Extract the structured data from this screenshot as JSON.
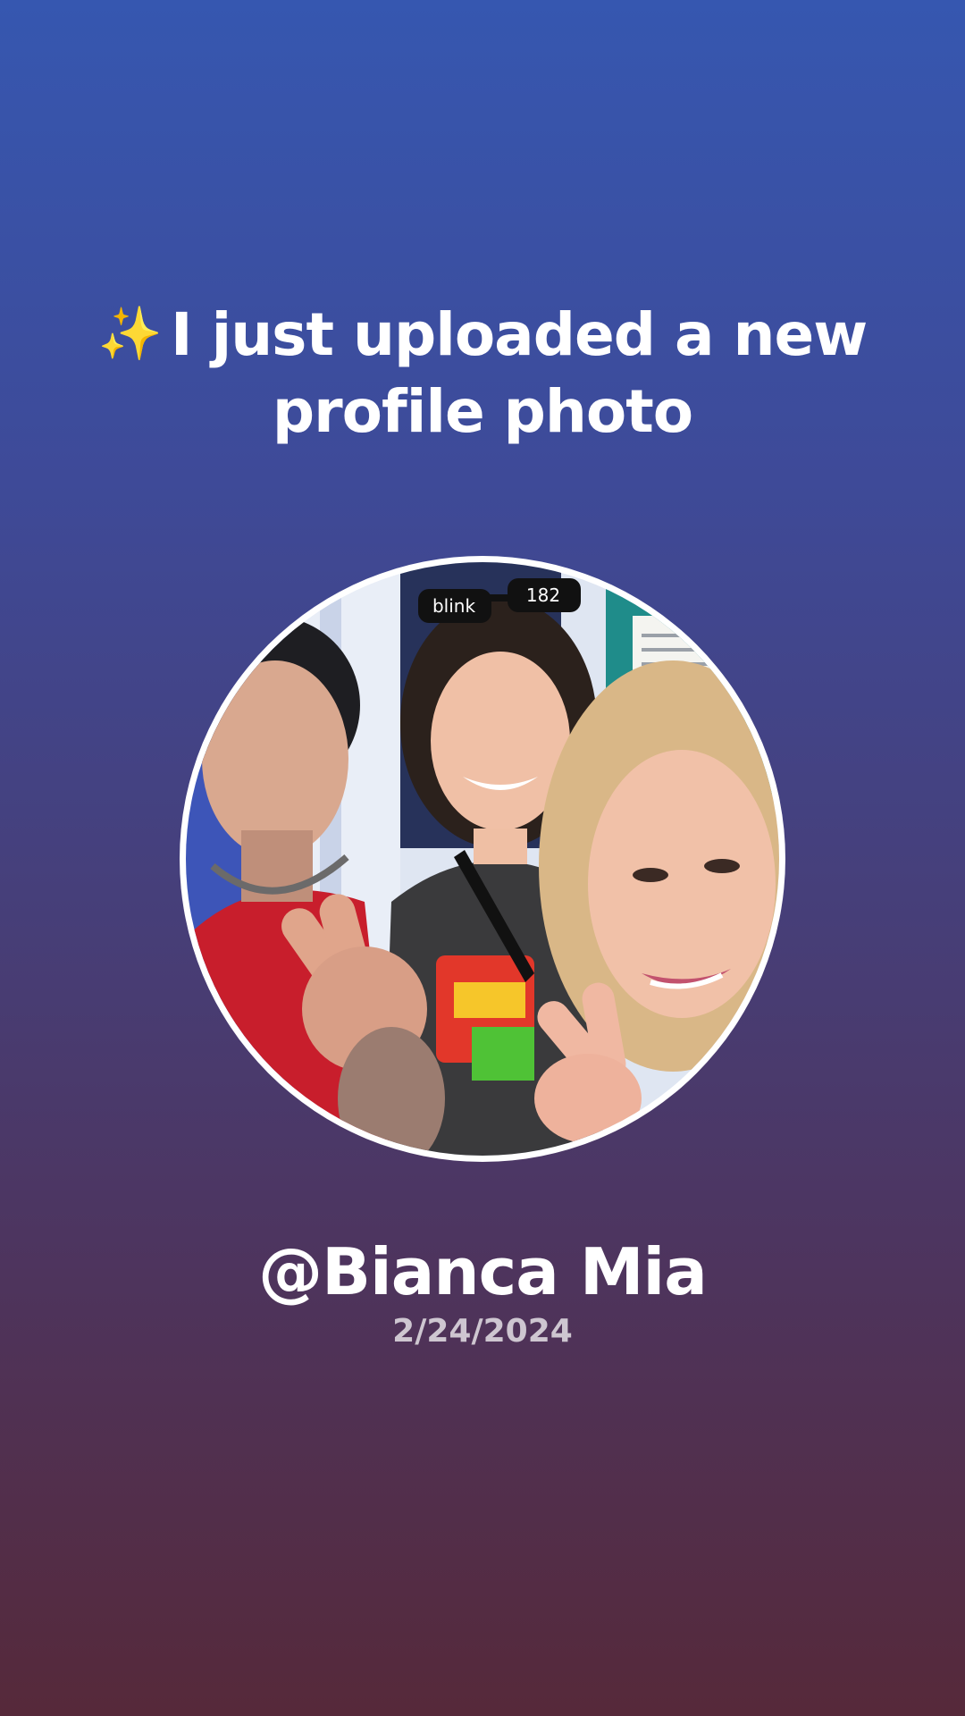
{
  "headline": {
    "icon": "sparkles-icon",
    "icon_glyph": "✨",
    "text_line1": "I just uploaded a new",
    "text_line2": "profile photo"
  },
  "profile": {
    "photo_alt": "New profile photo: three people taking a selfie, one wearing blink-182 sunglasses and a blink-182 shirt",
    "photo_sunglasses_text": "blink 182",
    "username": "@Bianca Mia",
    "date": "2/24/2024"
  },
  "colors": {
    "gradient_top": "#3657b0",
    "gradient_bottom": "#56293a",
    "text": "#ffffff",
    "date_text": "rgba(255,255,255,0.72)",
    "sparkle": "#ffd24a"
  }
}
